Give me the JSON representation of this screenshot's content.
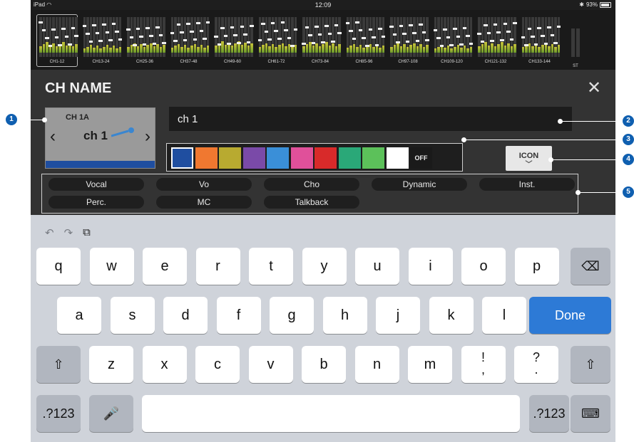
{
  "status": {
    "device": "iPad",
    "time": "12:09",
    "battery": "93%"
  },
  "meter_strip": {
    "channel_groups": [
      "CH1-12",
      "CH13-24",
      "CH25-36",
      "CH37-48",
      "CH49-60",
      "CH61-72",
      "CH73-84",
      "CH85-96",
      "CH97-108",
      "CH109-120",
      "CH121-132",
      "CH133-144"
    ],
    "stereo_label": "ST"
  },
  "panel": {
    "title": "CH NAME",
    "channel_id": "CH 1A",
    "channel_name": "ch 1",
    "name_value": "ch 1",
    "selected_color": "#1f4ea0",
    "colors": [
      "#1f4ea0",
      "#f07830",
      "#b8aa30",
      "#7a4aa8",
      "#3a8fd8",
      "#e0509a",
      "#d82a2a",
      "#2aa878",
      "#5cc15a",
      "#ffffff"
    ],
    "off_label": "OFF",
    "icon_button_label": "ICON"
  },
  "presets": {
    "row1": [
      "Vocal",
      "Vo",
      "Cho",
      "Dynamic",
      "Inst."
    ],
    "row2": [
      "Perc.",
      "MC",
      "Talkback"
    ]
  },
  "keyboard": {
    "row1": [
      "q",
      "w",
      "e",
      "r",
      "t",
      "y",
      "u",
      "i",
      "o",
      "p"
    ],
    "row2": [
      "a",
      "s",
      "d",
      "f",
      "g",
      "h",
      "j",
      "k",
      "l"
    ],
    "done_label": "Done",
    "row3": [
      "z",
      "x",
      "c",
      "v",
      "b",
      "n",
      "m"
    ],
    "punct1_top": "!",
    "punct1_bottom": ",",
    "punct2_top": "?",
    "punct2_bottom": ".",
    "numbers_label": ".?123"
  },
  "annotations": [
    "1",
    "2",
    "3",
    "4",
    "5"
  ]
}
